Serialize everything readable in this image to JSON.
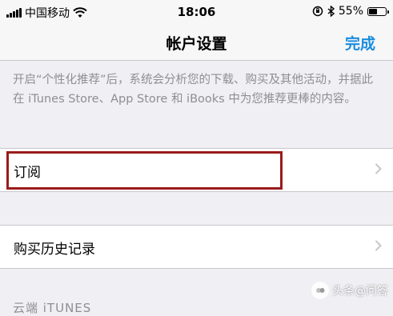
{
  "status_bar": {
    "carrier": "中国移动",
    "time": "18:06",
    "battery_percent_label": "55%",
    "battery_level": 0.55,
    "icons": [
      "signal-icon",
      "wifi-icon",
      "orientation-lock-icon",
      "bluetooth-icon",
      "battery-icon"
    ]
  },
  "nav": {
    "title": "帐户设置",
    "done_label": "完成"
  },
  "description": "开启“个性化推荐”后，系统会分析您的下载、购买及其他活动，并据此在 iTunes Store、App Store 和 iBooks 中为您推荐更棒的内容。",
  "cells": [
    {
      "label": "订阅"
    },
    {
      "label": "购买历史记录"
    }
  ],
  "section_header": "云端 iTUNES",
  "watermark": {
    "text": "头条@问答"
  },
  "colors": {
    "accent": "#1a8ddf",
    "highlight_box": "#9b1b1b",
    "background": "#efeff4"
  }
}
